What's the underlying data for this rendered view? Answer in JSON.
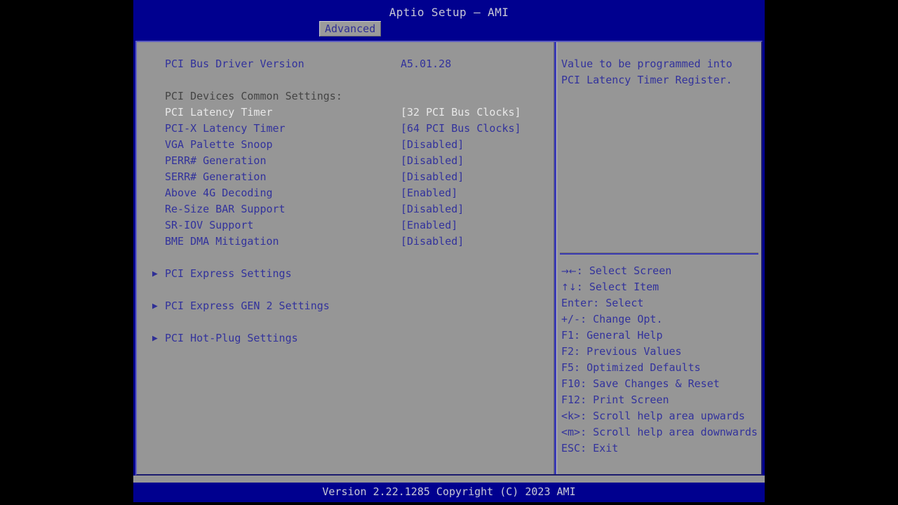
{
  "window": {
    "title": "Aptio Setup – AMI",
    "active_tab": "Advanced",
    "footer": "Version 2.22.1285 Copyright (C) 2023 AMI"
  },
  "main": {
    "driver_version_label": "PCI Bus Driver Version",
    "driver_version_value": "A5.01.28",
    "section_header": "PCI Devices Common Settings:",
    "settings": [
      {
        "label": "PCI Latency Timer",
        "value": "[32 PCI Bus Clocks]",
        "selected": true
      },
      {
        "label": "PCI-X Latency Timer",
        "value": "[64 PCI Bus Clocks]",
        "selected": false
      },
      {
        "label": "VGA Palette Snoop",
        "value": "[Disabled]",
        "selected": false
      },
      {
        "label": "PERR# Generation",
        "value": "[Disabled]",
        "selected": false
      },
      {
        "label": "SERR# Generation",
        "value": "[Disabled]",
        "selected": false
      },
      {
        "label": "Above 4G Decoding",
        "value": "[Enabled]",
        "selected": false
      },
      {
        "label": "Re-Size BAR Support",
        "value": "[Disabled]",
        "selected": false
      },
      {
        "label": "SR-IOV Support",
        "value": "[Enabled]",
        "selected": false
      },
      {
        "label": "BME DMA Mitigation",
        "value": "[Disabled]",
        "selected": false
      }
    ],
    "submenus": [
      {
        "bullet": "▶",
        "label": "PCI Express Settings"
      },
      {
        "bullet": "▶",
        "label": "PCI Express GEN 2 Settings"
      },
      {
        "bullet": "▶",
        "label": "PCI Hot-Plug Settings"
      }
    ]
  },
  "help": {
    "description": "Value to be programmed into\nPCI Latency Timer Register.",
    "keys": [
      {
        "glyph": "→←",
        "text": ": Select Screen"
      },
      {
        "glyph": "↑↓",
        "text": ": Select Item"
      },
      {
        "glyph": "",
        "text": "Enter: Select"
      },
      {
        "glyph": "",
        "text": "+/-: Change Opt."
      },
      {
        "glyph": "",
        "text": "F1: General Help"
      },
      {
        "glyph": "",
        "text": "F2: Previous Values"
      },
      {
        "glyph": "",
        "text": "F5: Optimized Defaults"
      },
      {
        "glyph": "",
        "text": "F10: Save Changes & Reset"
      },
      {
        "glyph": "",
        "text": "F12: Print Screen"
      },
      {
        "glyph": "",
        "text": "<k>: Scroll help area upwards"
      },
      {
        "glyph": "",
        "text": "<m>: Scroll help area downwards"
      },
      {
        "glyph": "",
        "text": "ESC: Exit"
      }
    ]
  },
  "colors": {
    "background": "#000000",
    "screen_blue": "#00008f",
    "panel_gray": "#969696",
    "text_blue": "#32329c",
    "text_selected": "#e8e8e8",
    "title_text": "#c9c9d6",
    "divider_blue": "#3b3bb4"
  }
}
